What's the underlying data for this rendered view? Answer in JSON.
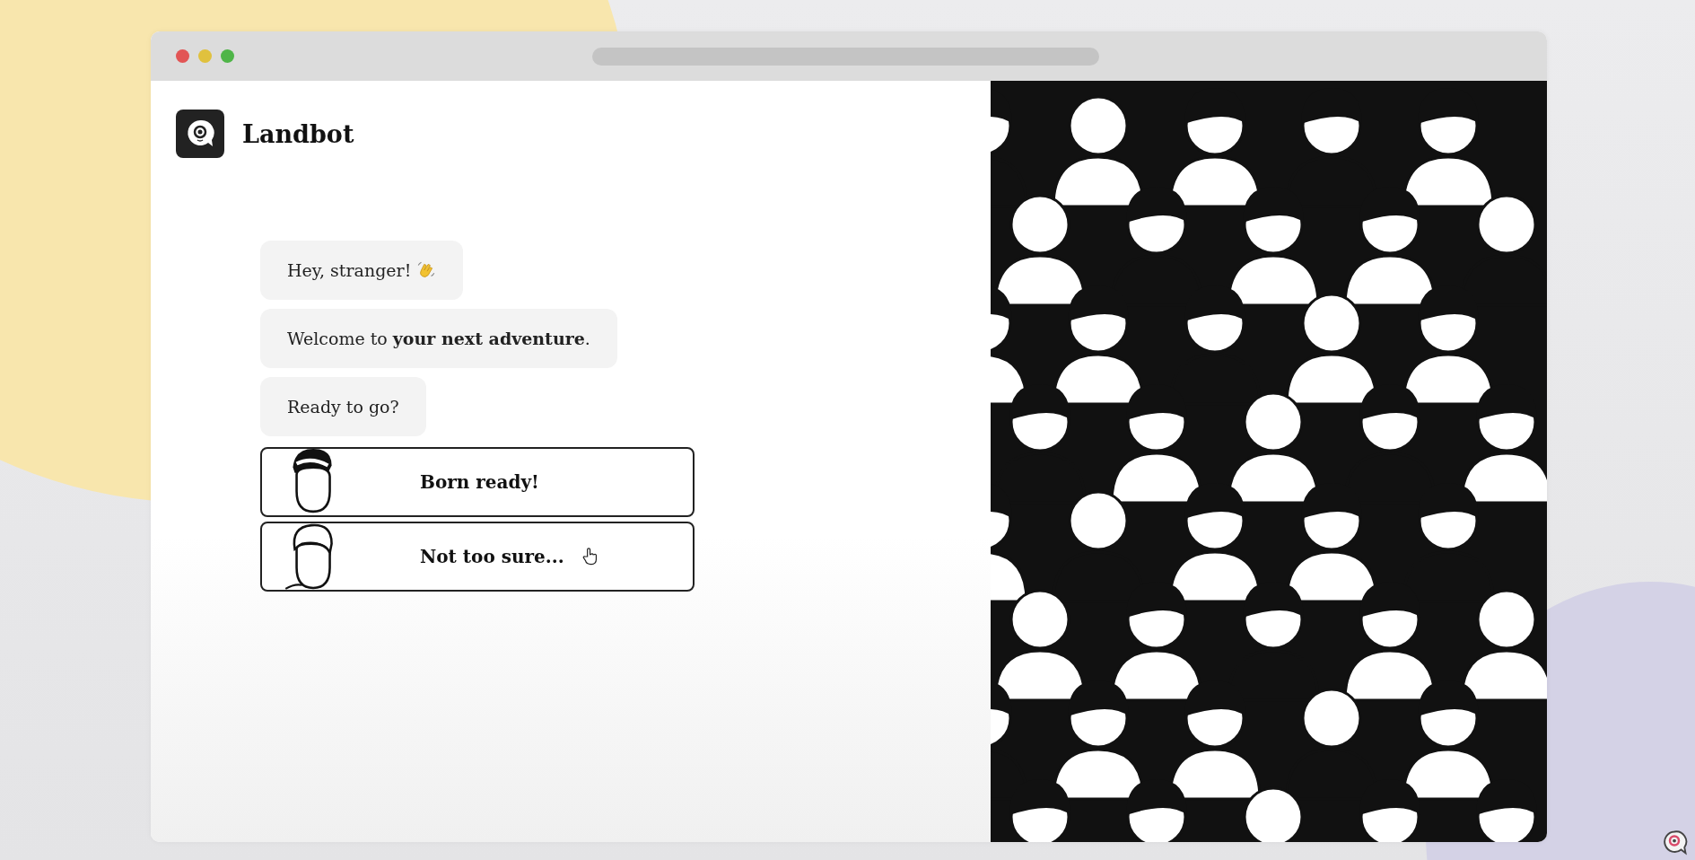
{
  "window": {
    "address_bar": {
      "kind": "empty"
    }
  },
  "brand": {
    "name": "Landbot"
  },
  "messages": [
    {
      "text": "Hey, stranger!",
      "kind": "wave"
    },
    {
      "text": "Welcome to **your next adventure**."
    },
    {
      "text": "Ready to go?"
    }
  ],
  "options": [
    {
      "label": "Born ready!",
      "kind": "bun",
      "hovered": false
    },
    {
      "label": "Not too sure...",
      "kind": "quiff",
      "hovered": true
    }
  ],
  "corner_badge": {
    "kind": "logo"
  }
}
